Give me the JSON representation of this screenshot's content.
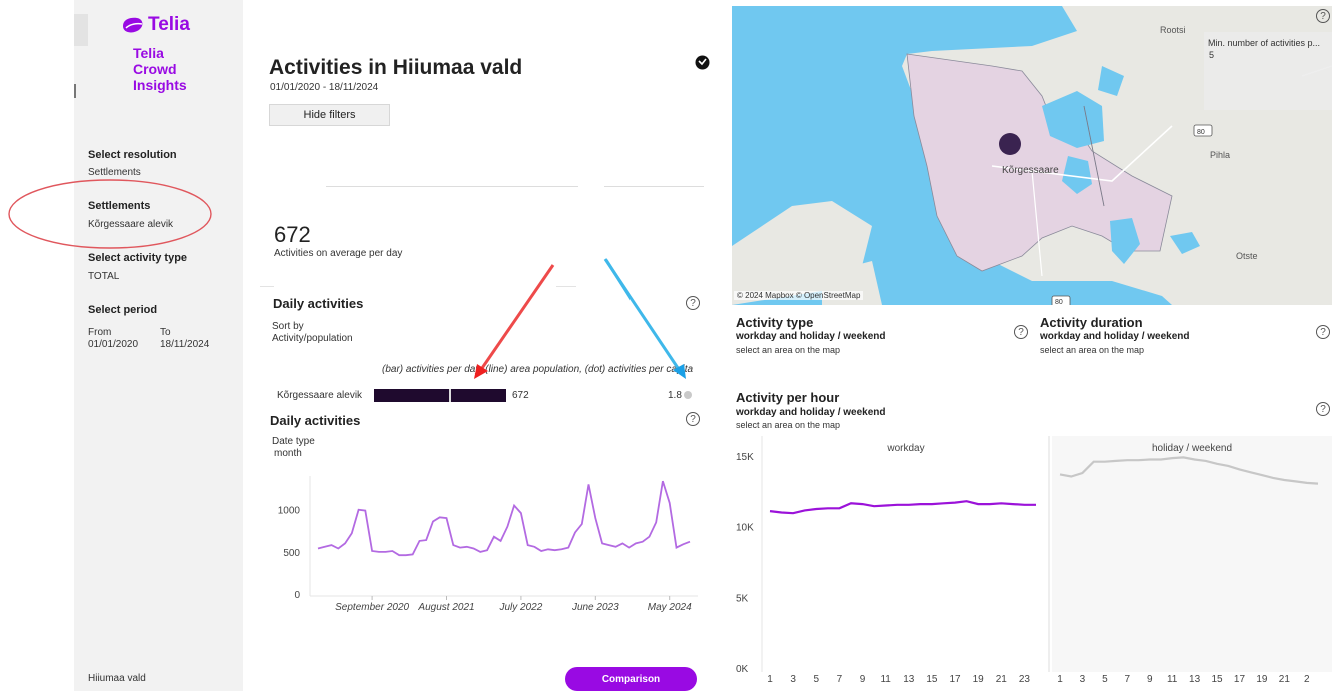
{
  "brand": {
    "name": "Telia",
    "lines": [
      "Telia",
      "Crowd",
      "Insights"
    ],
    "color": "#990ae3"
  },
  "sidebar": {
    "resolution_label": "Select resolution",
    "resolution_value": "Settlements",
    "settlements_label": "Settlements",
    "settlements_value": "Kõrgessaare alevik",
    "activity_type_label": "Select activity type",
    "activity_type_value": "TOTAL",
    "period_label": "Select period",
    "from_label": "From",
    "from_value": "01/01/2020",
    "to_label": "To",
    "to_value": "18/11/2024",
    "footer": "Hiiumaa vald"
  },
  "main": {
    "title": "Activities in Hiiumaa vald",
    "date_range": "01/01/2020 - 18/11/2024",
    "hide_filters": "Hide filters",
    "kpi_value": "672",
    "kpi_label": "Activities on average per day",
    "daily_title": "Daily activities",
    "sort_label": "Sort by",
    "sort_value": "Activity/population",
    "bar_caption": "(bar) activities per day, (line) area population, (dot) activities per capita",
    "bar_row": {
      "label": "Kõrgessaare alevik",
      "value": "672",
      "per_capita": "1.8",
      "fraction": 1.0
    },
    "daily_title2": "Daily activities",
    "date_type_label": "Date type",
    "date_type_value": "month",
    "comparison_button": "Comparison",
    "help_icon_glyph": "?"
  },
  "chart_data": [
    {
      "type": "line",
      "title": "",
      "xlabel": "",
      "ylabel": "",
      "ylim": [
        0,
        1400
      ],
      "yticks": [
        0,
        500,
        1000
      ],
      "xtick_labels": [
        "September 2020",
        "August 2021",
        "July 2022",
        "June 2023",
        "May 2024"
      ],
      "xtick_index": [
        8,
        19,
        30,
        41,
        52
      ],
      "color": "#b36ae2",
      "values": [
        540,
        560,
        580,
        540,
        600,
        720,
        1000,
        990,
        510,
        500,
        500,
        510,
        460,
        460,
        470,
        630,
        640,
        860,
        910,
        900,
        580,
        550,
        560,
        540,
        500,
        520,
        680,
        630,
        800,
        1050,
        960,
        580,
        560,
        510,
        530,
        520,
        530,
        550,
        730,
        830,
        1300,
        900,
        600,
        580,
        560,
        600,
        550,
        600,
        620,
        680,
        850,
        1340,
        1080,
        550,
        590,
        620
      ]
    },
    {
      "type": "line",
      "title": "Activity per hour",
      "panels": [
        "workday",
        "holiday / weekend"
      ],
      "ylim": [
        0,
        15000
      ],
      "ytick_labels": [
        "0K",
        "5K",
        "10K",
        "15K"
      ],
      "ytick_values": [
        0,
        5000,
        10000,
        15000
      ],
      "x": [
        0,
        1,
        2,
        3,
        4,
        5,
        6,
        7,
        8,
        9,
        10,
        11,
        12,
        13,
        14,
        15,
        16,
        17,
        18,
        19,
        20,
        21,
        22,
        23
      ],
      "xtick_labels": [
        "1",
        "3",
        "5",
        "7",
        "9",
        "11",
        "13",
        "15",
        "17",
        "19",
        "21",
        "23"
      ],
      "xtick_labels_right": [
        "1",
        "3",
        "5",
        "7",
        "9",
        "11",
        "13",
        "15",
        "17",
        "19",
        "21",
        "2"
      ],
      "series": [
        {
          "name": "workday",
          "color": "#9b12d9",
          "values": [
            11100,
            11000,
            10950,
            11150,
            11250,
            11300,
            11300,
            11650,
            11600,
            11450,
            11500,
            11550,
            11550,
            11600,
            11600,
            11650,
            11700,
            11800,
            11600,
            11600,
            11650,
            11600,
            11550,
            11550
          ]
        },
        {
          "name": "holiday / weekend",
          "color": "#c7c7c7",
          "values": [
            13700,
            13550,
            13800,
            14600,
            14600,
            14650,
            14700,
            14700,
            14750,
            14750,
            14850,
            14900,
            14750,
            14650,
            14450,
            14300,
            14050,
            13850,
            13650,
            13450,
            13300,
            13200,
            13100,
            13050
          ]
        }
      ]
    }
  ],
  "map": {
    "roads_badge_1": "80",
    "roads_badge_2": "80",
    "place_rootsi": "Rootsi",
    "place_korgessaare": "Kõrgessaare",
    "place_pihla": "Pihla",
    "place_otste": "Otste",
    "attribution": "© 2024 Mapbox © OpenStreetMap",
    "min_activities_label": "Min. number of activities p...",
    "min_activities_value": "5",
    "water_color": "#70c8f0",
    "land_color": "#e8e8e3",
    "area_color": "#e4d3e2"
  },
  "right": {
    "activity_type_title": "Activity type",
    "activity_type_sub": "workday  and holiday / weekend",
    "activity_type_hint": "select an area on the map",
    "activity_duration_title": "Activity duration",
    "activity_duration_sub": "workday and holiday / weekend",
    "activity_duration_hint": "select an area on the map",
    "per_hour_title": "Activity per hour",
    "per_hour_sub": "workday and holiday / weekend",
    "per_hour_hint": "select an area on the map",
    "panel_left": "workday",
    "panel_right": "holiday / weekend"
  }
}
